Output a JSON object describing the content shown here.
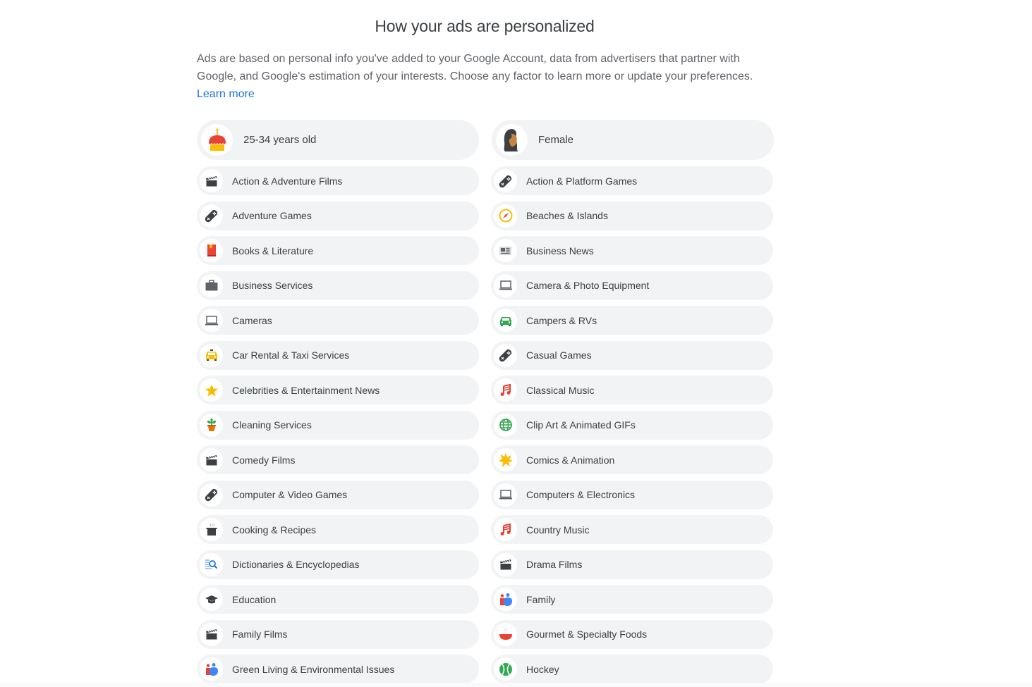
{
  "header": {
    "title": "How your ads are personalized",
    "intro_text": "Ads are based on personal info you've added to your Google Account, data from advertisers that partner with Google, and Google's estimation of your interests. Choose any factor to learn more or update your preferences.",
    "learn_more_label": "Learn more"
  },
  "demographics": [
    {
      "label": "25-34 years old",
      "icon": "birthday-cake-icon"
    },
    {
      "label": "Female",
      "icon": "female-avatar-icon"
    }
  ],
  "interests": [
    {
      "label": "Action & Adventure Films",
      "icon": "clapperboard-icon"
    },
    {
      "label": "Action & Platform Games",
      "icon": "gamepad-icon"
    },
    {
      "label": "Adventure Games",
      "icon": "gamepad-icon"
    },
    {
      "label": "Beaches & Islands",
      "icon": "compass-icon"
    },
    {
      "label": "Books & Literature",
      "icon": "book-icon"
    },
    {
      "label": "Business News",
      "icon": "newspaper-icon"
    },
    {
      "label": "Business Services",
      "icon": "briefcase-icon"
    },
    {
      "label": "Camera & Photo Equipment",
      "icon": "laptop-icon"
    },
    {
      "label": "Cameras",
      "icon": "laptop-icon"
    },
    {
      "label": "Campers & RVs",
      "icon": "car-icon"
    },
    {
      "label": "Car Rental & Taxi Services",
      "icon": "taxi-icon"
    },
    {
      "label": "Casual Games",
      "icon": "gamepad-icon"
    },
    {
      "label": "Celebrities & Entertainment News",
      "icon": "star-icon"
    },
    {
      "label": "Classical Music",
      "icon": "music-note-icon"
    },
    {
      "label": "Cleaning Services",
      "icon": "potted-plant-icon"
    },
    {
      "label": "Clip Art & Animated GIFs",
      "icon": "globe-icon"
    },
    {
      "label": "Comedy Films",
      "icon": "clapperboard-icon"
    },
    {
      "label": "Comics & Animation",
      "icon": "burst-icon"
    },
    {
      "label": "Computer & Video Games",
      "icon": "gamepad-icon"
    },
    {
      "label": "Computers & Electronics",
      "icon": "laptop-icon"
    },
    {
      "label": "Cooking & Recipes",
      "icon": "cooking-pot-icon"
    },
    {
      "label": "Country Music",
      "icon": "music-note-icon"
    },
    {
      "label": "Dictionaries & Encyclopedias",
      "icon": "search-document-icon"
    },
    {
      "label": "Drama Films",
      "icon": "clapperboard-icon"
    },
    {
      "label": "Education",
      "icon": "graduation-cap-icon"
    },
    {
      "label": "Family",
      "icon": "family-icon"
    },
    {
      "label": "Family Films",
      "icon": "clapperboard-icon"
    },
    {
      "label": "Gourmet & Specialty Foods",
      "icon": "soup-bowl-icon"
    },
    {
      "label": "Green Living & Environmental Issues",
      "icon": "family-icon"
    },
    {
      "label": "Hockey",
      "icon": "ball-icon"
    }
  ],
  "colors": {
    "pill_background": "#f1f3f4",
    "link": "#1a73e8",
    "text": "#3c4043"
  }
}
